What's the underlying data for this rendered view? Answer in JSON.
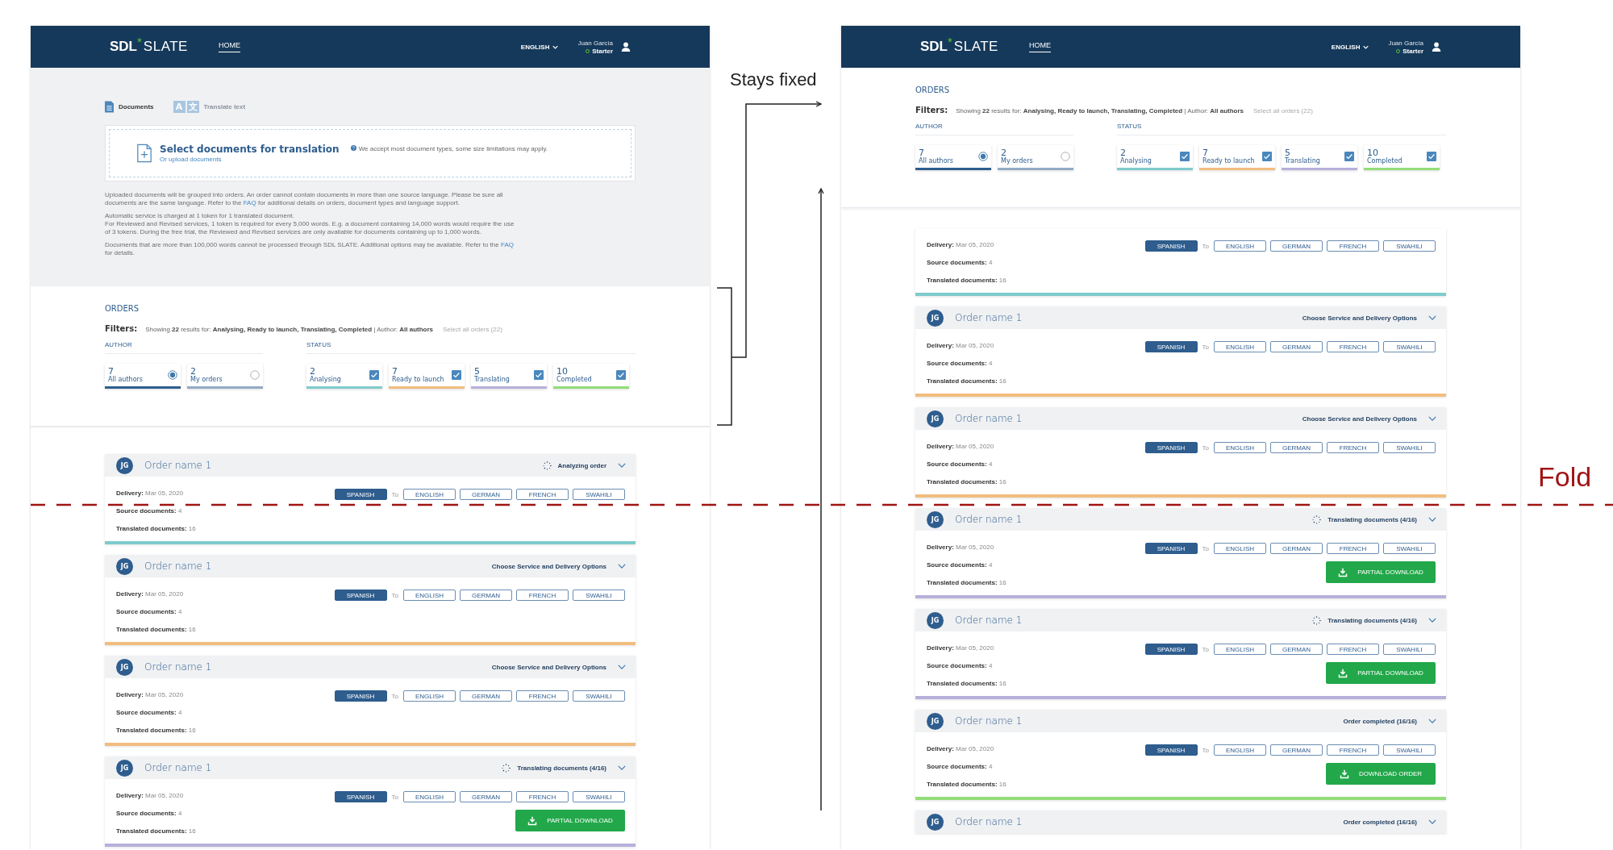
{
  "annotations": {
    "fixed_label": "Stays fixed",
    "fold_label": "Fold"
  },
  "screens": [
    {
      "kind": "initial",
      "header": {
        "logo": {
          "brand": "SDL",
          "mark": "*",
          "product": "SLATE"
        },
        "nav": [
          {
            "label": "HOME",
            "selected": true
          }
        ],
        "language": "ENGLISH",
        "user": {
          "name": "Juan García",
          "plan": "Starter"
        }
      },
      "upload": {
        "tabs": [
          {
            "label": "Documents",
            "selected": true
          },
          {
            "label": "Translate text",
            "selected": false,
            "icon_text": [
              "A",
              "文"
            ]
          }
        ],
        "dropzone": {
          "title": "Select documents for translation",
          "link": "Or upload documents",
          "hint": "We accept most document types, some size limitations may apply."
        },
        "notes": [
          {
            "lines": [
              {
                "text": "Uploaded documents will be grouped into orders. An order cannot contain documents in more than one source language. Please be sure all documents are the same language. Refer to the ",
                "link": "FAQ",
                "after": " for additional details on orders, document types and language support."
              }
            ]
          },
          {
            "lines": [
              {
                "text": "Automatic service is charged at 1 token for 1 translated document."
              },
              {
                "text": "For Reviewed and Revised services, 1 token is required for every 5,000 words. E.g. a document containing 14,000 words would require the use of 3 tokens. During the free trial, the Reviewed and Revised services are only available for documents containing up to 1,000 words."
              }
            ]
          },
          {
            "lines": [
              {
                "text": "Documents that are more than 100,000 words cannot be processed through SDL SLATE. Additional options may be available. Refer to the ",
                "link": "FAQ",
                "after": " for details."
              }
            ]
          }
        ]
      },
      "orders": {
        "title": "ORDERS",
        "filters_label": "Filters:",
        "summary": "Showing **22** results for: **Analysing, Ready to launch, Translating, Completed** | Author: **All authors**",
        "select_all": "Select all orders (22)",
        "author_label": "AUTHOR",
        "status_label": "STATUS",
        "authors": [
          {
            "count": "7",
            "label": "All authors",
            "selected": true,
            "color": "#2e5d8e"
          },
          {
            "count": "2",
            "label": "My orders",
            "selected": false,
            "color": "#94aac6"
          }
        ],
        "statuses": [
          {
            "count": "2",
            "label": "Analysing",
            "checked": true,
            "color": "#7fcbcd"
          },
          {
            "count": "7",
            "label": "Ready to launch",
            "checked": true,
            "color": "#f1bd80"
          },
          {
            "count": "5",
            "label": "Translating",
            "checked": true,
            "color": "#b8b0db"
          },
          {
            "count": "10",
            "label": "Completed",
            "checked": true,
            "color": "#93dc7a"
          }
        ],
        "cards": [
          {
            "initials": "JG",
            "name": "Order name 1",
            "status": "Analyzing order",
            "spinner": true,
            "delivery_label": "Delivery:",
            "delivery": "Mar 05, 2020",
            "source_label": "Source documents:",
            "source_count": "4",
            "translated_label": "Translated documents:",
            "translated_count": "16",
            "source_lang": "SPANISH",
            "to": "To",
            "targets": [
              "ENGLISH",
              "GERMAN",
              "FRENCH",
              "SWAHILI"
            ],
            "color": "#7fcbcd"
          },
          {
            "initials": "JG",
            "name": "Order name 1",
            "status": "Choose Service and Delivery Options",
            "spinner": false,
            "delivery_label": "Delivery:",
            "delivery": "Mar 05, 2020",
            "source_label": "Source documents:",
            "source_count": "4",
            "translated_label": "Translated documents:",
            "translated_count": "16",
            "source_lang": "SPANISH",
            "to": "To",
            "targets": [
              "ENGLISH",
              "GERMAN",
              "FRENCH",
              "SWAHILI"
            ],
            "color": "#f1bd80"
          },
          {
            "initials": "JG",
            "name": "Order name 1",
            "status": "Choose Service and Delivery Options",
            "spinner": false,
            "delivery_label": "Delivery:",
            "delivery": "Mar 05, 2020",
            "source_label": "Source documents:",
            "source_count": "4",
            "translated_label": "Translated documents:",
            "translated_count": "16",
            "source_lang": "SPANISH",
            "to": "To",
            "targets": [
              "ENGLISH",
              "GERMAN",
              "FRENCH",
              "SWAHILI"
            ],
            "color": "#f1bd80"
          },
          {
            "initials": "JG",
            "name": "Order name 1",
            "status": "Translating documents (4/16)",
            "spinner": true,
            "delivery_label": "Delivery:",
            "delivery": "Mar 05, 2020",
            "source_label": "Source documents:",
            "source_count": "4",
            "translated_label": "Translated documents:",
            "translated_count": "16",
            "source_lang": "SPANISH",
            "to": "To",
            "targets": [
              "ENGLISH",
              "GERMAN",
              "FRENCH",
              "SWAHILI"
            ],
            "button": "PARTIAL DOWNLOAD",
            "color": "#b8b0db"
          }
        ]
      }
    },
    {
      "kind": "scrolled",
      "header": {
        "logo": {
          "brand": "SDL",
          "mark": "*",
          "product": "SLATE"
        },
        "nav": [
          {
            "label": "HOME",
            "selected": true
          }
        ],
        "language": "ENGLISH",
        "user": {
          "name": "Juan García",
          "plan": "Starter"
        }
      },
      "orders": {
        "title": "ORDERS",
        "filters_label": "Filters:",
        "summary": "Showing **22** results for: **Analysing, Ready to launch, Translating, Completed** | Author: **All authors**",
        "select_all": "Select all orders (22)",
        "author_label": "AUTHOR",
        "status_label": "STATUS",
        "authors": [
          {
            "count": "7",
            "label": "All authors",
            "selected": true,
            "color": "#2e5d8e"
          },
          {
            "count": "2",
            "label": "My orders",
            "selected": false,
            "color": "#94aac6"
          }
        ],
        "statuses": [
          {
            "count": "2",
            "label": "Analysing",
            "checked": true,
            "color": "#7fcbcd"
          },
          {
            "count": "7",
            "label": "Ready to launch",
            "checked": true,
            "color": "#f1bd80"
          },
          {
            "count": "5",
            "label": "Translating",
            "checked": true,
            "color": "#b8b0db"
          },
          {
            "count": "10",
            "label": "Completed",
            "checked": true,
            "color": "#93dc7a"
          }
        ],
        "cards": [
          {
            "delivery_label": "Delivery:",
            "delivery": "Mar 05, 2020",
            "source_label": "Source documents:",
            "source_count": "4",
            "translated_label": "Translated documents:",
            "translated_count": "16",
            "source_lang": "SPANISH",
            "to": "To",
            "targets": [
              "ENGLISH",
              "GERMAN",
              "FRENCH",
              "SWAHILI"
            ],
            "color": "#7fcbcd"
          },
          {
            "initials": "JG",
            "name": "Order name 1",
            "status": "Choose Service and Delivery Options",
            "spinner": false,
            "delivery_label": "Delivery:",
            "delivery": "Mar 05, 2020",
            "source_label": "Source documents:",
            "source_count": "4",
            "translated_label": "Translated documents:",
            "translated_count": "16",
            "source_lang": "SPANISH",
            "to": "To",
            "targets": [
              "ENGLISH",
              "GERMAN",
              "FRENCH",
              "SWAHILI"
            ],
            "color": "#f1bd80"
          },
          {
            "initials": "JG",
            "name": "Order name 1",
            "status": "Choose Service and Delivery Options",
            "spinner": false,
            "delivery_label": "Delivery:",
            "delivery": "Mar 05, 2020",
            "source_label": "Source documents:",
            "source_count": "4",
            "translated_label": "Translated documents:",
            "translated_count": "16",
            "source_lang": "SPANISH",
            "to": "To",
            "targets": [
              "ENGLISH",
              "GERMAN",
              "FRENCH",
              "SWAHILI"
            ],
            "color": "#f1bd80"
          },
          {
            "initials": "JG",
            "name": "Order name 1",
            "status": "Translating documents (4/16)",
            "spinner": true,
            "delivery_label": "Delivery:",
            "delivery": "Mar 05, 2020",
            "source_label": "Source documents:",
            "source_count": "4",
            "translated_label": "Translated documents:",
            "translated_count": "16",
            "source_lang": "SPANISH",
            "to": "To",
            "targets": [
              "ENGLISH",
              "GERMAN",
              "FRENCH",
              "SWAHILI"
            ],
            "button": "PARTIAL DOWNLOAD",
            "color": "#b8b0db"
          },
          {
            "initials": "JG",
            "name": "Order name 1",
            "status": "Translating documents (4/16)",
            "spinner": true,
            "delivery_label": "Delivery:",
            "delivery": "Mar 05, 2020",
            "source_label": "Source documents:",
            "source_count": "4",
            "translated_label": "Translated documents:",
            "translated_count": "16",
            "source_lang": "SPANISH",
            "to": "To",
            "targets": [
              "ENGLISH",
              "GERMAN",
              "FRENCH",
              "SWAHILI"
            ],
            "button": "PARTIAL DOWNLOAD",
            "color": "#b8b0db"
          },
          {
            "initials": "JG",
            "name": "Order name 1",
            "status": "Order completed (16/16)",
            "spinner": false,
            "delivery_label": "Delivery:",
            "delivery": "Mar 05, 2020",
            "source_label": "Source documents:",
            "source_count": "4",
            "translated_label": "Translated documents:",
            "translated_count": "16",
            "source_lang": "SPANISH",
            "to": "To",
            "targets": [
              "ENGLISH",
              "GERMAN",
              "FRENCH",
              "SWAHILI"
            ],
            "button": "DOWNLOAD ORDER",
            "color": "#93dc7a"
          },
          {
            "initials": "JG",
            "name": "Order name 1",
            "status": "Order completed (16/16)",
            "spinner": false
          }
        ]
      }
    }
  ]
}
